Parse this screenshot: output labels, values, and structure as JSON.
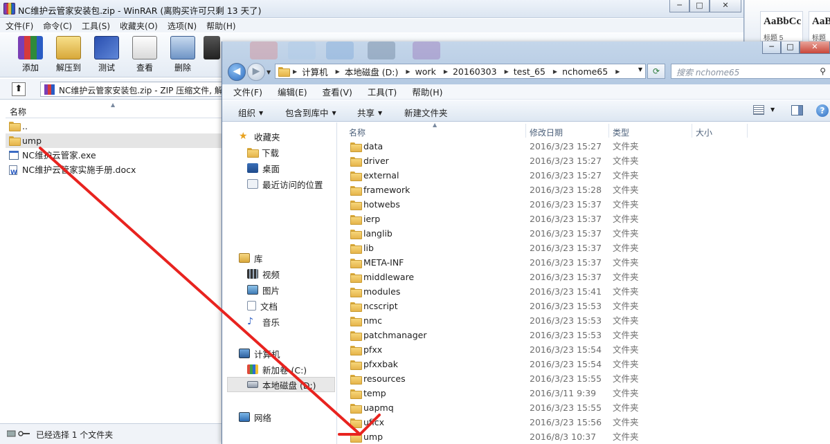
{
  "winrar": {
    "title": "NC维护云管家安装包.zip - WinRAR (离购买许可只剩 13 天了)",
    "window_buttons": [
      "─",
      "□",
      "✕"
    ],
    "menu": [
      "文件(F)",
      "命令(C)",
      "工具(S)",
      "收藏夹(O)",
      "选项(N)",
      "帮助(H)"
    ],
    "toolbar": [
      "添加",
      "解压到",
      "测试",
      "查看",
      "删除"
    ],
    "path": "NC维护云管家安装包.zip - ZIP 压缩文件, 解",
    "column_name": "名称",
    "files": [
      {
        "name": "..",
        "type": "folder"
      },
      {
        "name": "ump",
        "type": "folder"
      },
      {
        "name": "NC维护云管家.exe",
        "type": "exe"
      },
      {
        "name": "NC维护云管家实施手册.docx",
        "type": "docx"
      }
    ],
    "status": "已经选择 1 个文件夹"
  },
  "word": {
    "style1": "AaBbCc",
    "style1_sub": "标题 5",
    "style2": "AaBb",
    "style2_sub": "标题"
  },
  "explorer": {
    "window_buttons": [
      "─",
      "□",
      "✕"
    ],
    "address": [
      "计算机",
      "本地磁盘 (D:)",
      "work",
      "20160303",
      "test_65",
      "nchome65"
    ],
    "search_placeholder": "搜索 nchome65",
    "menu": [
      "文件(F)",
      "编辑(E)",
      "查看(V)",
      "工具(T)",
      "帮助(H)"
    ],
    "commands": [
      "组织",
      "包含到库中",
      "共享",
      "新建文件夹"
    ],
    "nav": {
      "favorites": "收藏夹",
      "downloads": "下载",
      "desktop": "桌面",
      "recent": "最近访问的位置",
      "libraries": "库",
      "videos": "视频",
      "pictures": "图片",
      "documents": "文档",
      "music": "音乐",
      "computer": "计算机",
      "drive_c": "新加卷 (C:)",
      "drive_d": "本地磁盘 (D:)",
      "network": "网络"
    },
    "columns": {
      "name": "名称",
      "date": "修改日期",
      "type": "类型",
      "size": "大小"
    },
    "files": [
      {
        "name": "data",
        "date": "2016/3/23 15:27",
        "type": "文件夹"
      },
      {
        "name": "driver",
        "date": "2016/3/23 15:27",
        "type": "文件夹"
      },
      {
        "name": "external",
        "date": "2016/3/23 15:27",
        "type": "文件夹"
      },
      {
        "name": "framework",
        "date": "2016/3/23 15:28",
        "type": "文件夹"
      },
      {
        "name": "hotwebs",
        "date": "2016/3/23 15:37",
        "type": "文件夹"
      },
      {
        "name": "ierp",
        "date": "2016/3/23 15:37",
        "type": "文件夹"
      },
      {
        "name": "langlib",
        "date": "2016/3/23 15:37",
        "type": "文件夹"
      },
      {
        "name": "lib",
        "date": "2016/3/23 15:37",
        "type": "文件夹"
      },
      {
        "name": "META-INF",
        "date": "2016/3/23 15:37",
        "type": "文件夹"
      },
      {
        "name": "middleware",
        "date": "2016/3/23 15:37",
        "type": "文件夹"
      },
      {
        "name": "modules",
        "date": "2016/3/23 15:41",
        "type": "文件夹"
      },
      {
        "name": "ncscript",
        "date": "2016/3/23 15:53",
        "type": "文件夹"
      },
      {
        "name": "nmc",
        "date": "2016/3/23 15:53",
        "type": "文件夹"
      },
      {
        "name": "patchmanager",
        "date": "2016/3/23 15:53",
        "type": "文件夹"
      },
      {
        "name": "pfxx",
        "date": "2016/3/23 15:54",
        "type": "文件夹"
      },
      {
        "name": "pfxxbak",
        "date": "2016/3/23 15:54",
        "type": "文件夹"
      },
      {
        "name": "resources",
        "date": "2016/3/23 15:55",
        "type": "文件夹"
      },
      {
        "name": "temp",
        "date": "2016/3/11 9:39",
        "type": "文件夹"
      },
      {
        "name": "uapmq",
        "date": "2016/3/23 15:55",
        "type": "文件夹"
      },
      {
        "name": "uficx",
        "date": "2016/3/23 15:56",
        "type": "文件夹"
      },
      {
        "name": "ump",
        "date": "2016/8/3 10:37",
        "type": "文件夹"
      }
    ]
  },
  "colors": {
    "annotation_arrow": "#e8231f",
    "titlebar": "#dbe5f1",
    "selection": "#e5e5e5"
  }
}
